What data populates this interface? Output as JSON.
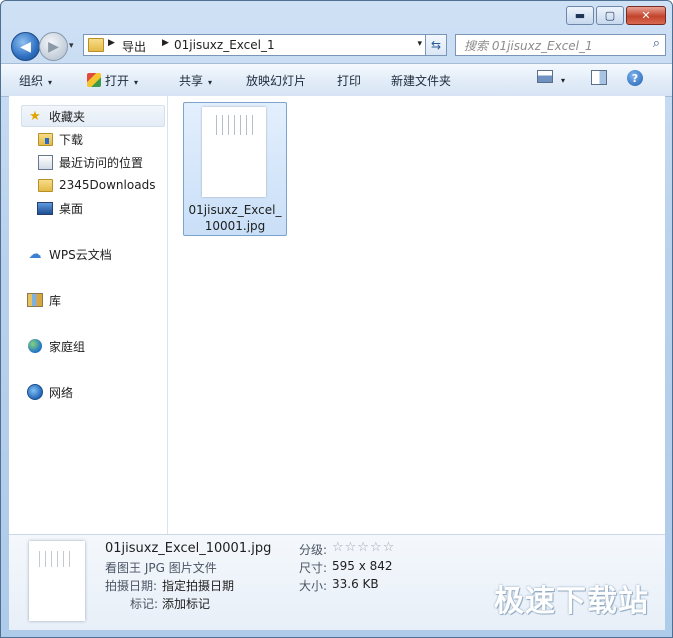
{
  "window": {
    "controls": {
      "minimize": "▬",
      "maximize": "▢",
      "close": "✕"
    }
  },
  "nav": {
    "back_glyph": "◀",
    "forward_glyph": "▶",
    "dropdown_glyph": "▾",
    "breadcrumb": [
      "导出",
      "01jisuxz_Excel_1"
    ],
    "crumb_separator": "▶",
    "address_dropdown": "▾",
    "refresh_glyph": "⇆",
    "search_placeholder": "搜索 01jisuxz_Excel_1",
    "search_glyph": "⌕"
  },
  "toolbar": {
    "organize": "组织",
    "open": "打开",
    "share": "共享",
    "slideshow": "放映幻灯片",
    "print": "打印",
    "new_folder": "新建文件夹",
    "dropdown_glyph": "▾",
    "help_glyph": "?"
  },
  "sidebar": {
    "favorites": "收藏夹",
    "items": [
      {
        "label": "下载",
        "icon": "download-folder-icon"
      },
      {
        "label": "最近访问的位置",
        "icon": "recent-places-icon"
      },
      {
        "label": "2345Downloads",
        "icon": "folder-icon"
      },
      {
        "label": "桌面",
        "icon": "desktop-icon"
      }
    ],
    "wps_cloud": "WPS云文档",
    "libraries": "库",
    "homegroup": "家庭组",
    "network": "网络"
  },
  "files": [
    {
      "name": "01jisuxz_Excel_10001.jpg"
    }
  ],
  "details": {
    "file_name": "01jisuxz_Excel_10001.jpg",
    "file_type": "看图王 JPG 图片文件",
    "date_label": "拍摄日期:",
    "date_value": "指定拍摄日期",
    "tags_label": "标记:",
    "tags_value": "添加标记",
    "rating_label": "分级:",
    "rating_stars": "☆☆☆☆☆",
    "dimensions_label": "尺寸:",
    "dimensions_value": "595 x 842",
    "size_label": "大小:",
    "size_value": "33.6 KB"
  },
  "watermark": "极速下载站"
}
